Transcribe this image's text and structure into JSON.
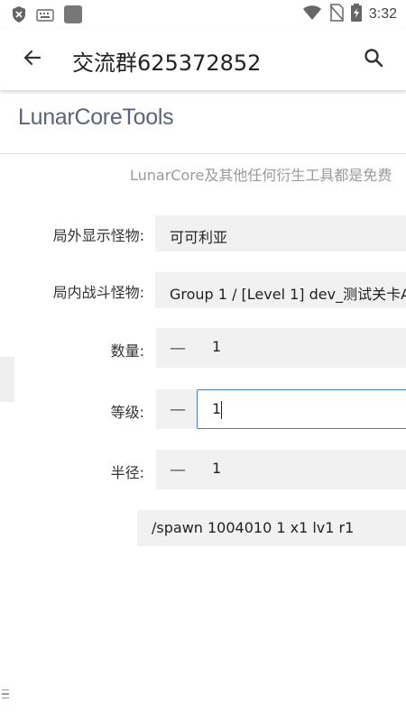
{
  "status_bar": {
    "time": "3:32",
    "icons": [
      "shield-icon",
      "keyboard-icon",
      "app-square-icon",
      "wifi-icon",
      "no-sim-icon",
      "battery-charging-icon"
    ]
  },
  "app_bar": {
    "title": "交流群625372852",
    "back_icon": "arrow-left-icon",
    "search_icon": "search-icon"
  },
  "brand": "LunarCoreTools",
  "notice": "LunarCore及其他任何衍生工具都是免费",
  "form": {
    "outside_monster": {
      "label": "局外显示怪物:",
      "value": "可可利亚"
    },
    "battle_monster": {
      "label": "局内战斗怪物:",
      "value": "Group 1 / [Level 1] dev_测试关卡A"
    },
    "quantity": {
      "label": "数量:",
      "value": "1",
      "minus": "—"
    },
    "level": {
      "label": "等级:",
      "value": "1",
      "minus": "—"
    },
    "radius": {
      "label": "半径:",
      "value": "1",
      "minus": "—"
    }
  },
  "command": "/spawn 1004010 1 x1 lv1 r1",
  "colors": {
    "brand": "#5a6478",
    "focus_border": "#4a7fc1",
    "field_bg": "#f1f1f1"
  }
}
